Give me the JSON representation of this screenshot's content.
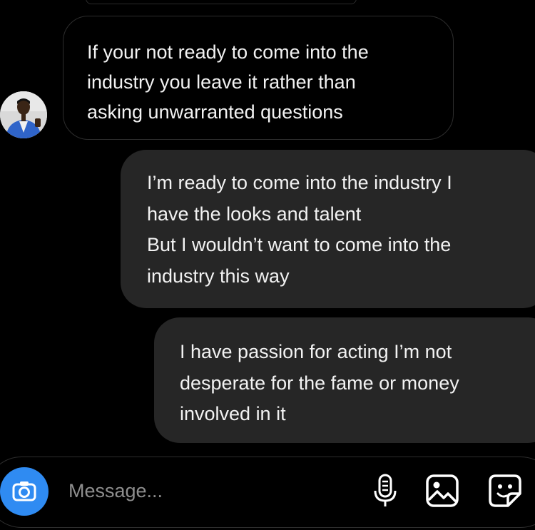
{
  "conversation": {
    "messages": [
      {
        "direction": "incoming",
        "text": "If your not ready to come into the\nindustry you leave it rather than\nasking unwarranted questions"
      },
      {
        "direction": "outgoing",
        "text": "I’m ready to come into the industry I\nhave the looks and talent\nBut I wouldn’t want to come into the\nindustry this way"
      },
      {
        "direction": "outgoing",
        "text": "I have passion for acting I’m not\ndesperate for the fame or money\ninvolved in it"
      }
    ]
  },
  "composer": {
    "placeholder": "Message...",
    "value": "",
    "accent_color": "#2f8bf2",
    "icons": [
      "camera-icon",
      "microphone-icon",
      "gallery-icon",
      "sticker-icon"
    ]
  },
  "theme": {
    "background": "#000000",
    "outgoing_bubble": "#262626",
    "incoming_border": "#2d2d2d",
    "text": "#f2f2f2",
    "placeholder": "#8e8e8e"
  }
}
